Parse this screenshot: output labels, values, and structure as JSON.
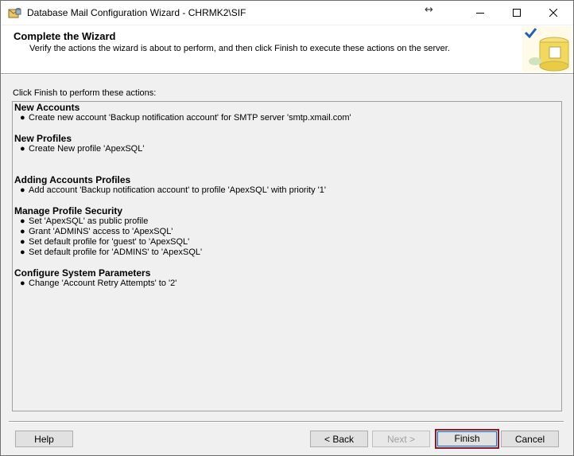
{
  "window": {
    "title": "Database Mail Configuration Wizard - CHRMK2\\SIF"
  },
  "header": {
    "title": "Complete the Wizard",
    "subtitle": "Verify the actions the wizard is about to perform, and then click Finish to execute these actions on the server."
  },
  "instruction": "Click Finish to perform these actions:",
  "sections": [
    {
      "heading": "New Accounts",
      "items": [
        "Create new account 'Backup notification account' for SMTP server 'smtp.xmail.com'"
      ]
    },
    {
      "heading": "New Profiles",
      "items": [
        "Create New profile 'ApexSQL'"
      ]
    },
    {
      "heading": "Adding Accounts Profiles",
      "items": [
        "Add account 'Backup notification account' to profile 'ApexSQL' with priority '1'"
      ]
    },
    {
      "heading": "Manage Profile Security",
      "items": [
        "Set 'ApexSQL' as public profile",
        "Grant 'ADMINS' access to 'ApexSQL'",
        "Set default profile for 'guest' to 'ApexSQL'",
        "Set default profile for 'ADMINS' to 'ApexSQL'"
      ]
    },
    {
      "heading": "Configure System Parameters",
      "items": [
        "Change 'Account Retry Attempts' to '2'"
      ]
    }
  ],
  "buttons": {
    "help": "Help",
    "back": "< Back",
    "next": "Next >",
    "finish": "Finish",
    "cancel": "Cancel"
  },
  "bullet": "●"
}
